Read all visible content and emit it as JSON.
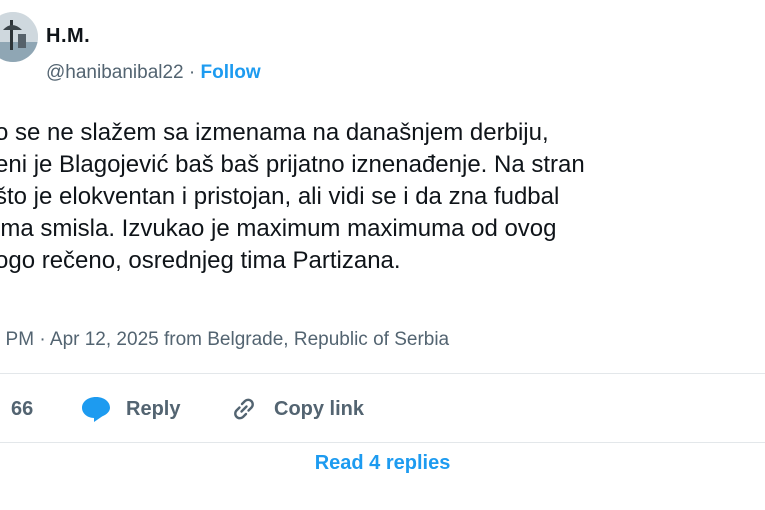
{
  "author": {
    "name": "H.M.",
    "handle": "@hanibanibal22",
    "separator": "·",
    "follow_label": "Follow"
  },
  "tweet": {
    "lines": [
      "o se ne slažem sa izmenama na današnjem derbiju,",
      "eni je Blagojević baš baš prijatno iznenađenje. Na stran",
      "što je elokventan i pristojan, ali vidi se i da zna fudbal",
      " ima smisla. Izvukao je maximum maximuma od ovog",
      "ogo rečeno, osrednjeg tima Partizana."
    ],
    "meta": ". PM · Apr 12, 2025 from Belgrade, Republic of Serbia"
  },
  "actions": {
    "like_count": "66",
    "reply_label": "Reply",
    "copy_link_label": "Copy link"
  },
  "footer": {
    "read_replies_label": "Read 4 replies"
  },
  "colors": {
    "accent": "#1d9bf0",
    "secondary_text": "#536471",
    "divider": "#e3e7ea"
  }
}
